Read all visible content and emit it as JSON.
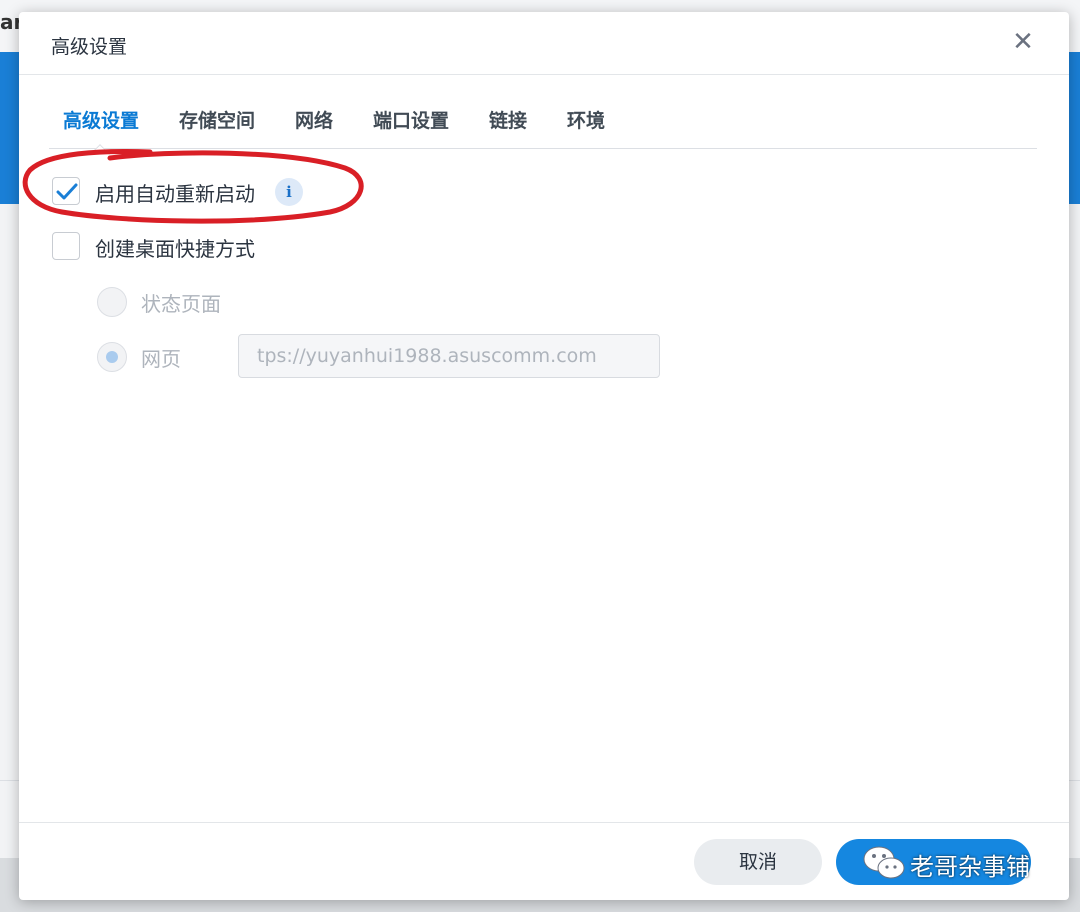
{
  "background_app": {
    "title_fragment": "ar"
  },
  "dialog": {
    "title": "高级设置",
    "close_label": "✕"
  },
  "tabs": [
    {
      "label": "高级设置",
      "active": true
    },
    {
      "label": "存储空间",
      "active": false
    },
    {
      "label": "网络",
      "active": false
    },
    {
      "label": "端口设置",
      "active": false
    },
    {
      "label": "链接",
      "active": false
    },
    {
      "label": "环境",
      "active": false
    }
  ],
  "options": {
    "auto_restart": {
      "label": "启用自动重新启动",
      "checked": true,
      "info_icon": "i"
    },
    "desktop_shortcut": {
      "label": "创建桌面快捷方式",
      "checked": false
    }
  },
  "shortcut_target": {
    "status_page": {
      "label": "状态页面",
      "selected": false
    },
    "web_page": {
      "label": "网页",
      "selected": true,
      "url": "tps://yuyanhui1988.asuscomm.com"
    }
  },
  "footer": {
    "cancel_label": "取消"
  },
  "watermark": {
    "text": "老哥杂事铺"
  },
  "colors": {
    "accent": "#0a7ad4",
    "primary_button": "#1587e0",
    "annotation_red": "#d91f26"
  }
}
